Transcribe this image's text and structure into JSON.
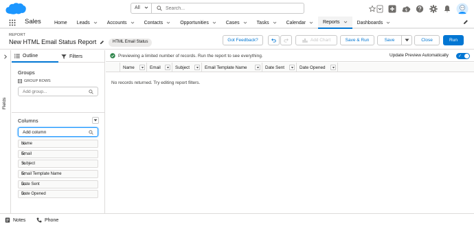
{
  "header": {
    "search_scope": "All",
    "search_placeholder": "Search..."
  },
  "nav": {
    "app_name": "Sales",
    "items": [
      {
        "label": "Home",
        "has_menu": false
      },
      {
        "label": "Leads",
        "has_menu": true
      },
      {
        "label": "Accounts",
        "has_menu": true
      },
      {
        "label": "Contacts",
        "has_menu": true
      },
      {
        "label": "Opportunities",
        "has_menu": true
      },
      {
        "label": "Cases",
        "has_menu": true
      },
      {
        "label": "Tasks",
        "has_menu": true
      },
      {
        "label": "Calendar",
        "has_menu": true
      },
      {
        "label": "Reports",
        "has_menu": true,
        "active": true
      },
      {
        "label": "Dashboards",
        "has_menu": true
      }
    ]
  },
  "page_header": {
    "object_label": "REPORT",
    "title": "New HTML Email Status Report",
    "report_type_badge": "HTML Email Status",
    "buttons": {
      "feedback": "Got Feedback?",
      "add_chart": "Add Chart",
      "save_run": "Save & Run",
      "save": "Save",
      "close": "Close",
      "run": "Run"
    }
  },
  "fields_rail": {
    "label": "Fields"
  },
  "left_panel": {
    "tabs": {
      "outline": "Outline",
      "filters": "Filters"
    },
    "groups": {
      "title": "Groups",
      "group_rows_label": "GROUP ROWS",
      "add_group_placeholder": "Add group..."
    },
    "columns": {
      "title": "Columns",
      "add_column_value": "Add column",
      "items": [
        "Name",
        "Email",
        "Subject",
        "Email Template Name",
        "Date Sent",
        "Date Opened"
      ]
    }
  },
  "preview": {
    "limited_message": "Previewing a limited number of records. Run the report to see everything.",
    "auto_preview_label": "Update Preview Automatically",
    "auto_preview_on": true,
    "columns": [
      "Name",
      "Email",
      "Subject",
      "Email Template Name",
      "Date Sent",
      "Date Opened"
    ],
    "empty_message": "No records returned. Try editing report filters."
  },
  "utility_bar": {
    "notes": "Notes",
    "phone": "Phone"
  },
  "colors": {
    "brand": "#0176d3",
    "cloud": "#1b96ff"
  }
}
